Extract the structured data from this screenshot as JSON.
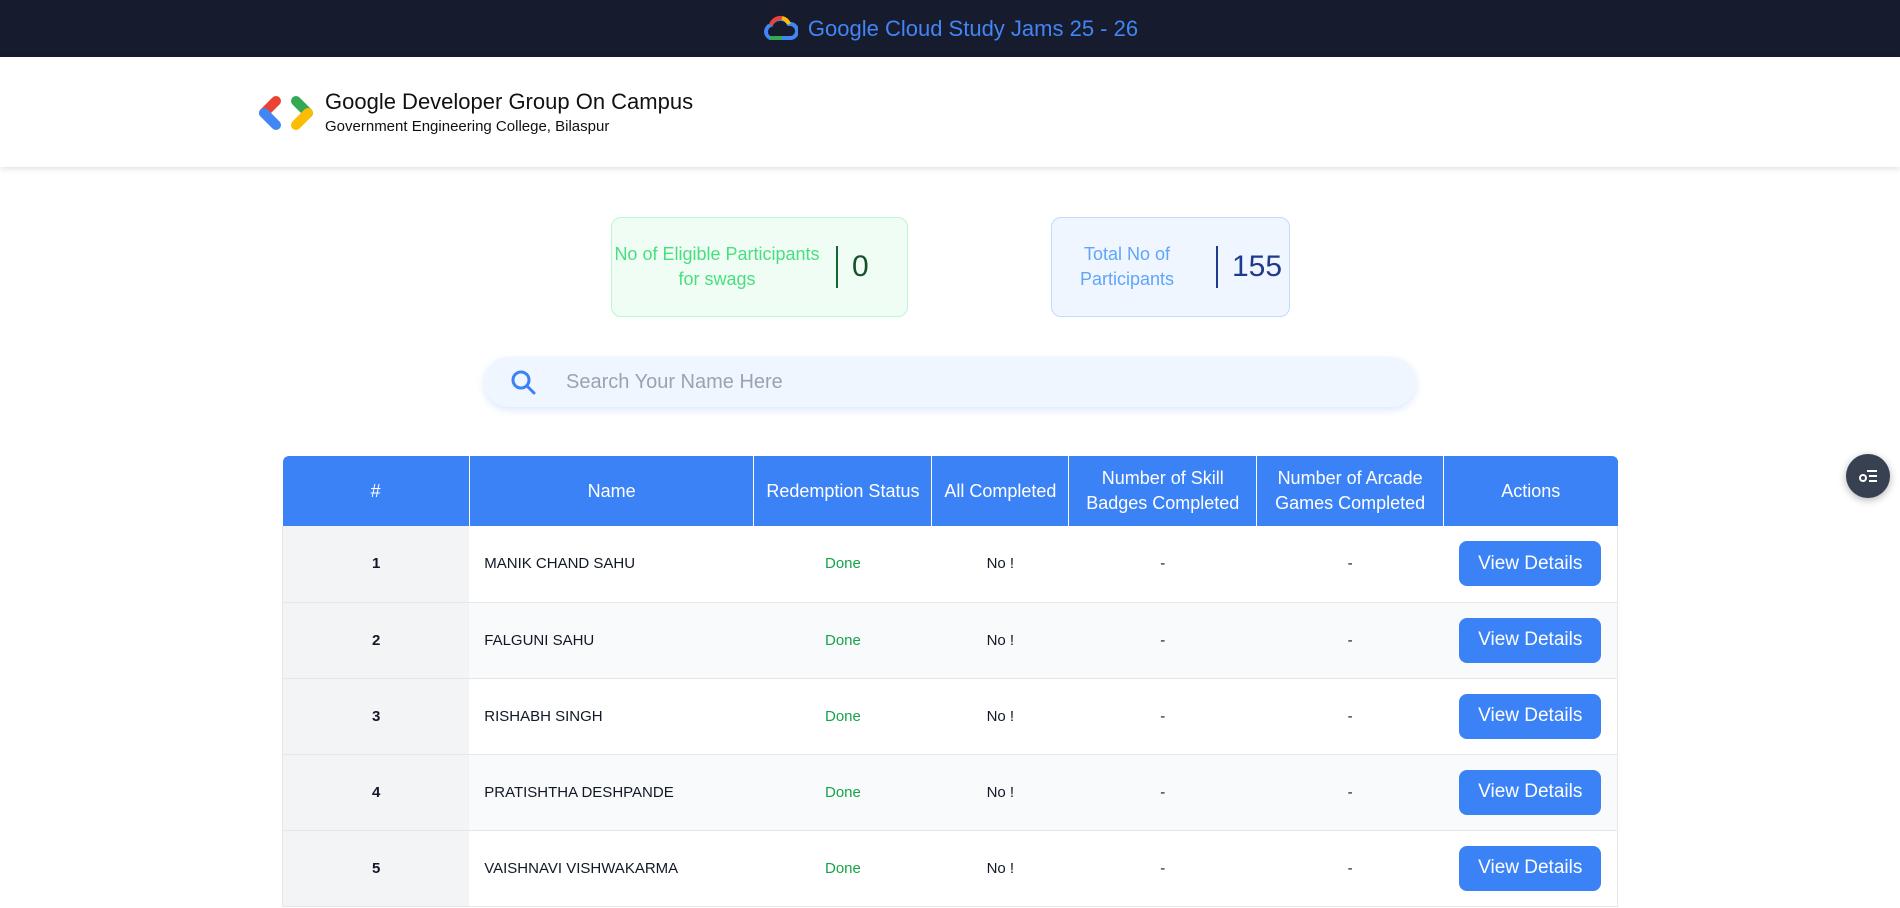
{
  "topbar": {
    "title": "Google Cloud Study Jams 25 - 26"
  },
  "header": {
    "org_name": "Google Developer Group On Campus",
    "college": "Government Engineering College, Bilaspur"
  },
  "stats": {
    "eligible": {
      "label": "No of Eligible Participants for swags",
      "value": "0"
    },
    "total": {
      "label": "Total No of Participants",
      "value": "155"
    }
  },
  "search": {
    "placeholder": "Search Your Name Here",
    "value": ""
  },
  "table": {
    "headers": [
      "#",
      "Name",
      "Redemption Status",
      "All Completed",
      "Number of Skill Badges Completed",
      "Number of Arcade Games Completed",
      "Actions"
    ],
    "rows": [
      {
        "num": "1",
        "name": "MANIK CHAND SAHU",
        "status": "Done",
        "all": "No !",
        "skill": "-",
        "arcade": "-",
        "action": "View Details"
      },
      {
        "num": "2",
        "name": "FALGUNI SAHU",
        "status": "Done",
        "all": "No !",
        "skill": "-",
        "arcade": "-",
        "action": "View Details"
      },
      {
        "num": "3",
        "name": "RISHABH SINGH",
        "status": "Done",
        "all": "No !",
        "skill": "-",
        "arcade": "-",
        "action": "View Details"
      },
      {
        "num": "4",
        "name": "PRATISHTHA DESHPANDE",
        "status": "Done",
        "all": "No !",
        "skill": "-",
        "arcade": "-",
        "action": "View Details"
      },
      {
        "num": "5",
        "name": "VAISHNAVI VISHWAKARMA",
        "status": "Done",
        "all": "No !",
        "skill": "-",
        "arcade": "-",
        "action": "View Details"
      }
    ]
  },
  "icons": {
    "cloud": "google-cloud-icon",
    "logo": "gdg-logo-icon",
    "search": "search-icon",
    "fab": "list-settings-icon"
  },
  "colors": {
    "accent": "#3b82f6",
    "topbar_bg": "#161b2e",
    "done": "#16a34a"
  }
}
